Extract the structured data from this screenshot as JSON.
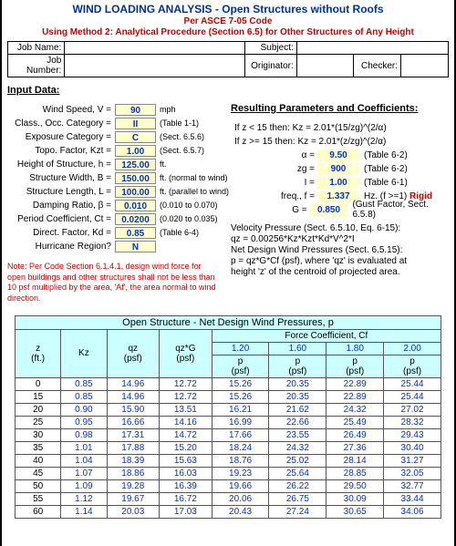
{
  "title": "WIND LOADING ANALYSIS - Open Structures without Roofs",
  "subtitle1": "Per ASCE 7-05 Code",
  "subtitle2": "Using Method 2: Analytical Procedure (Section 6.5) for Other Structures of Any Height",
  "header": {
    "jobname_lbl": "Job Name:",
    "jobnumber_lbl": "Job Number:",
    "subject_lbl": "Subject:",
    "originator_lbl": "Originator:",
    "checker_lbl": "Checker:",
    "jobname": "",
    "jobnumber": "",
    "subject": "",
    "originator": "",
    "checker": ""
  },
  "inputs_title": "Input Data:",
  "inputs": {
    "wind_speed_lbl": "Wind Speed, V =",
    "wind_speed": "90",
    "wind_speed_unit": "mph",
    "occ_cat_lbl": "Class., Occ. Category =",
    "occ_cat": "II",
    "occ_cat_note": "(Table 1-1)",
    "exp_cat_lbl": "Exposure Category =",
    "exp_cat": "C",
    "exp_cat_note": "(Sect. 6.5.6)",
    "kzt_lbl": "Topo. Factor, Kzt =",
    "kzt": "1.00",
    "kzt_note": "(Sect. 6.5.7)",
    "h_lbl": "Height of Structure, h =",
    "h": "125.00",
    "h_unit": "ft.",
    "B_lbl": "Structure Width, B =",
    "B": "150.00",
    "B_unit": "ft. (normal to wind)",
    "L_lbl": "Structure Length, L =",
    "L": "100.00",
    "L_unit": "ft. (parallel to wind)",
    "beta_lbl": "Damping Ratio, β =",
    "beta": "0.010",
    "beta_note": "(0.010 to 0.070)",
    "ct_lbl": "Period Coefficient, Ct =",
    "ct": "0.0200",
    "ct_note": "(0.020 to 0.035)",
    "kd_lbl": "Direct. Factor, Kd =",
    "kd": "0.85",
    "kd_note": "(Table 6-4)",
    "hurr_lbl": "Hurricane Region?",
    "hurr": "N"
  },
  "note_text": "Note: Per Code Section 6.1.4.1, design wind force for open buildings and other structures shall not be less than 10 psf multiplied by the area, 'Af', the area normal to wind direction.",
  "results_title": "Resulting Parameters and Coefficients:",
  "results": {
    "kz_low": "If  z < 15  then:  Kz = 2.01*(15/zg)^(2/α)",
    "kz_high": "If  z >= 15  then:  Kz = 2.01*(z/zg)^(2/α)",
    "alpha_lbl": "α =",
    "alpha": "9.50",
    "alpha_note": "(Table 6-2)",
    "zg_lbl": "zg =",
    "zg": "900",
    "zg_note": "(Table 6-2)",
    "I_lbl": "I =",
    "I": "1.00",
    "I_note": "(Table 6-1)",
    "f_lbl": "freq., f =",
    "f": "1.337",
    "f_note_pre": "Hz. (f >=1)",
    "f_note_rigid": "Rigid",
    "G_lbl": "G =",
    "G": "0.850",
    "G_note": "(Gust Factor, Sect. 6.5.8)"
  },
  "velocity": {
    "title": "Velocity Pressure (Sect. 6.5.10, Eq. 6-15):",
    "qz_eq": "qz = 0.00256*Kz*Kzt*Kd*V^2*I",
    "net_title": "Net Design Wind Pressures (Sect. 6.5.15):",
    "p_eq": "p = qz*G*Cf  (psf), where 'qz' is evaluated at",
    "p_eq2": "   height 'z' of the centroid of projected area."
  },
  "wind_table": {
    "title": "Open Structure - Net Design Wind Pressures, p",
    "force_coef": "Force Coefficient, Cf",
    "cols": {
      "z": "z",
      "z_unit": "(ft.)",
      "kz": "Kz",
      "qz": "qz",
      "qz_unit": "(psf)",
      "qzg": "qz*G",
      "qzg_unit": "(psf)",
      "p": "p",
      "p_unit": "(psf)"
    },
    "cf": [
      "1.20",
      "1.60",
      "1.80",
      "2.00"
    ],
    "rows": [
      {
        "z": "0",
        "kz": "0.85",
        "qz": "14.96",
        "qzg": "12.72",
        "p": [
          "15.26",
          "20.35",
          "22.89",
          "25.44"
        ]
      },
      {
        "z": "15",
        "kz": "0.85",
        "qz": "14.96",
        "qzg": "12.72",
        "p": [
          "15.26",
          "20.35",
          "22.89",
          "25.44"
        ]
      },
      {
        "z": "20",
        "kz": "0.90",
        "qz": "15.90",
        "qzg": "13.51",
        "p": [
          "16.21",
          "21.62",
          "24.32",
          "27.02"
        ]
      },
      {
        "z": "25",
        "kz": "0.95",
        "qz": "16.66",
        "qzg": "14.16",
        "p": [
          "16.99",
          "22.66",
          "25.49",
          "28.32"
        ]
      },
      {
        "z": "30",
        "kz": "0.98",
        "qz": "17.31",
        "qzg": "14.72",
        "p": [
          "17.66",
          "23.55",
          "26.49",
          "29.43"
        ]
      },
      {
        "z": "35",
        "kz": "1.01",
        "qz": "17.88",
        "qzg": "15.20",
        "p": [
          "18.24",
          "24.32",
          "27.36",
          "30.40"
        ]
      },
      {
        "z": "40",
        "kz": "1.04",
        "qz": "18.39",
        "qzg": "15.63",
        "p": [
          "18.76",
          "25.02",
          "28.14",
          "31.27"
        ]
      },
      {
        "z": "45",
        "kz": "1.07",
        "qz": "18.86",
        "qzg": "16.03",
        "p": [
          "19.23",
          "25.64",
          "28.85",
          "32.05"
        ]
      },
      {
        "z": "50",
        "kz": "1.09",
        "qz": "19.28",
        "qzg": "16.39",
        "p": [
          "19.66",
          "26.22",
          "29.50",
          "32.77"
        ]
      },
      {
        "z": "55",
        "kz": "1.12",
        "qz": "19.67",
        "qzg": "16.72",
        "p": [
          "20.06",
          "26.75",
          "30.09",
          "33.44"
        ]
      },
      {
        "z": "60",
        "kz": "1.14",
        "qz": "20.03",
        "qzg": "17.03",
        "p": [
          "20.43",
          "27.24",
          "30.65",
          "34.06"
        ]
      }
    ]
  }
}
